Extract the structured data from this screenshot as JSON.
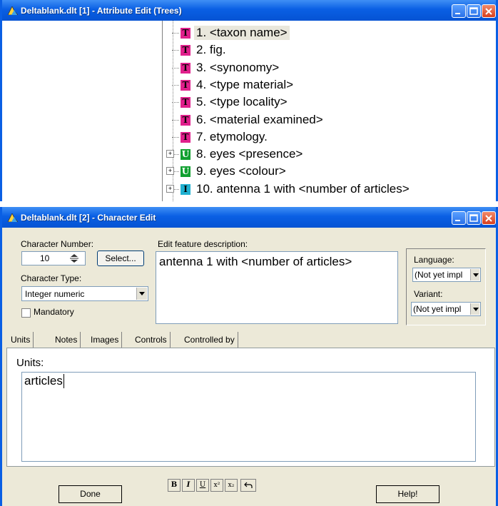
{
  "window1": {
    "title": "Deltablank.dlt [1] - Attribute Edit (Trees)",
    "tree": [
      {
        "badge": "T",
        "label": "1. <taxon name>",
        "selected": true
      },
      {
        "badge": "T",
        "label": "2. fig."
      },
      {
        "badge": "T",
        "label": "3. <synonomy>"
      },
      {
        "badge": "T",
        "label": "4. <type material>"
      },
      {
        "badge": "T",
        "label": "5. <type locality>"
      },
      {
        "badge": "T",
        "label": "6. <material examined>"
      },
      {
        "badge": "T",
        "label": "7. etymology."
      },
      {
        "badge": "U",
        "label": "8. eyes <presence>",
        "expander": "+"
      },
      {
        "badge": "U",
        "label": "9. eyes <colour>",
        "expander": "+"
      },
      {
        "badge": "I",
        "label": "10. antenna 1 with <number of articles>",
        "expander": "+"
      }
    ]
  },
  "window2": {
    "title": "Deltablank.dlt [2] - Character Edit",
    "character_number_label": "Character Number:",
    "character_number_value": "10",
    "select_button": "Select...",
    "character_type_label": "Character Type:",
    "character_type_value": "Integer numeric",
    "mandatory_label": "Mandatory",
    "edit_feature_label": "Edit feature description:",
    "feature_description": "antenna 1 with <number of articles>",
    "language_label": "Language:",
    "language_value": "(Not yet impl",
    "variant_label": "Variant:",
    "variant_value": "(Not yet impl",
    "tabs": [
      "Units",
      "Notes",
      "Images",
      "Controls",
      "Controlled by"
    ],
    "units_label": "Units:",
    "units_value": "articles",
    "done_button": "Done",
    "help_button": "Help!",
    "format_buttons": [
      "B",
      "I",
      "U",
      "x²",
      "x₂",
      "undo"
    ]
  },
  "colors": {
    "badge_T": "#e0208c",
    "badge_U": "#10a030",
    "badge_I": "#20b0d0",
    "titlebar": "#0a5fe4"
  }
}
